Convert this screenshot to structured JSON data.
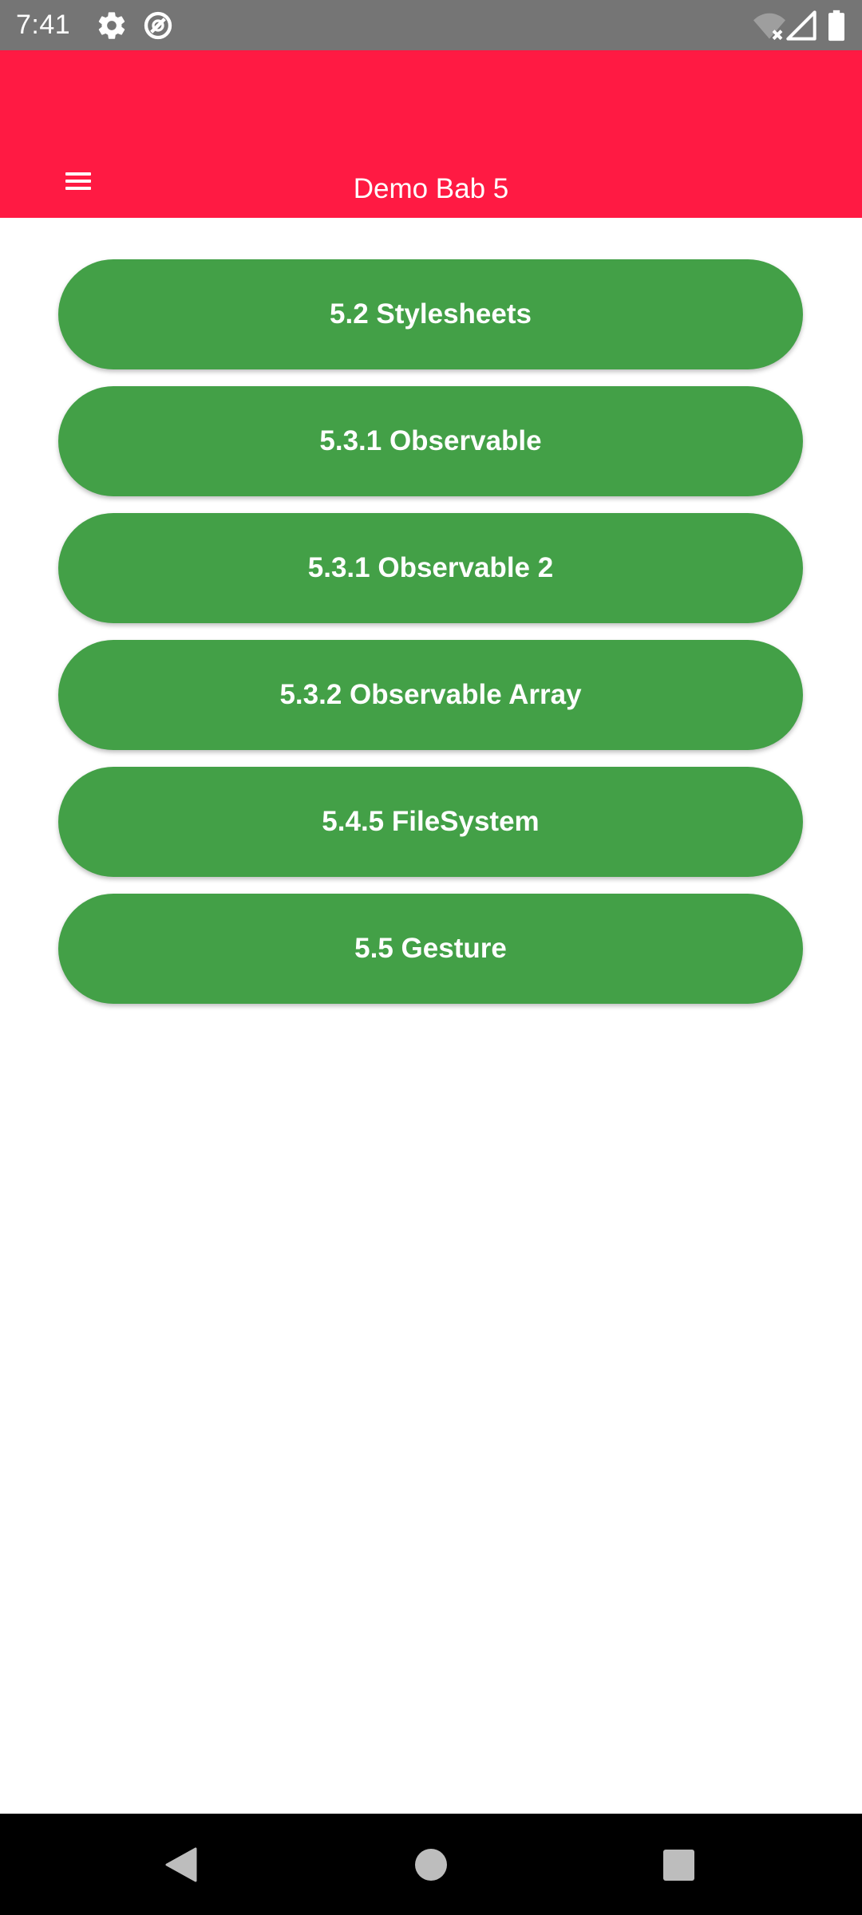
{
  "status_bar": {
    "time": "7:41",
    "icons": [
      "gear-icon",
      "sync-off-icon",
      "wifi-off-icon",
      "signal-icon",
      "battery-icon"
    ]
  },
  "app_bar": {
    "title": "Demo Bab 5",
    "menu_icon": "hamburger-menu-icon",
    "background": "#ff1a43"
  },
  "buttons": [
    {
      "label": "5.2 Stylesheets"
    },
    {
      "label": "5.3.1 Observable"
    },
    {
      "label": "5.3.1 Observable 2"
    },
    {
      "label": "5.3.2 Observable Array"
    },
    {
      "label": "5.4.5 FileSystem"
    },
    {
      "label": "5.5 Gesture"
    }
  ],
  "button_color": "#43a047",
  "nav_bar": {
    "icons": [
      "back-icon",
      "home-icon",
      "recents-icon"
    ]
  }
}
